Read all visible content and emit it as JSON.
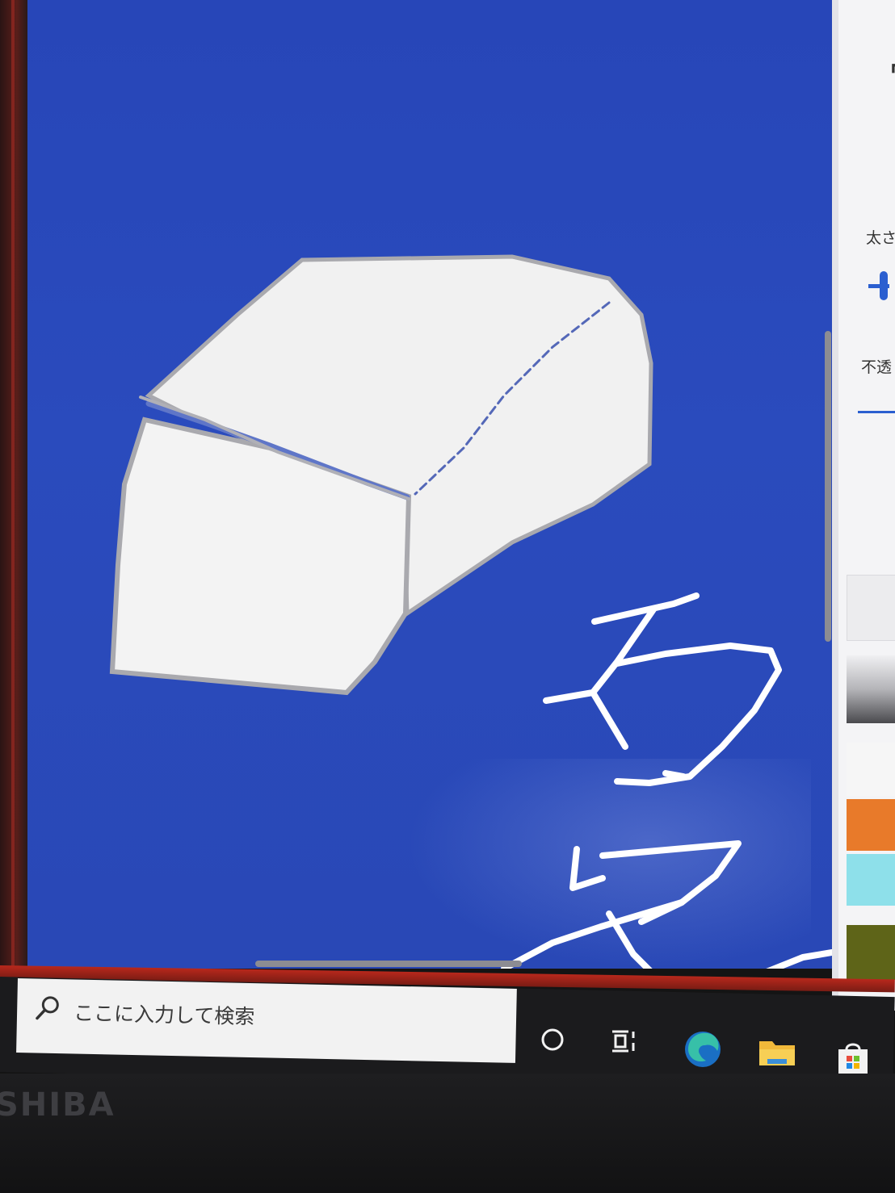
{
  "app": {
    "canvas_color": "#2a4bbd",
    "drawing_stroke_color": "#ffffff"
  },
  "right_panel": {
    "thickness_label": "太さ",
    "opacity_label": "不透",
    "accent_color": "#2b5fd0",
    "color_swatches": [
      {
        "name": "white",
        "hex": "#f4f4f4"
      },
      {
        "name": "light-gray",
        "hex": "#e8e8ea"
      },
      {
        "name": "silver-gradient",
        "hex": "#b8b8bc"
      },
      {
        "name": "white-2",
        "hex": "#f6f6f6"
      },
      {
        "name": "orange",
        "hex": "#e87a2a"
      },
      {
        "name": "light-cyan",
        "hex": "#8ee0ea"
      },
      {
        "name": "olive",
        "hex": "#5e6418"
      }
    ]
  },
  "taskbar": {
    "search_placeholder": "ここに入力して検索",
    "icons": [
      "cortana-icon",
      "task-view-icon",
      "edge-icon",
      "file-explorer-icon",
      "store-icon"
    ]
  },
  "device": {
    "brand": "SHIBA"
  }
}
